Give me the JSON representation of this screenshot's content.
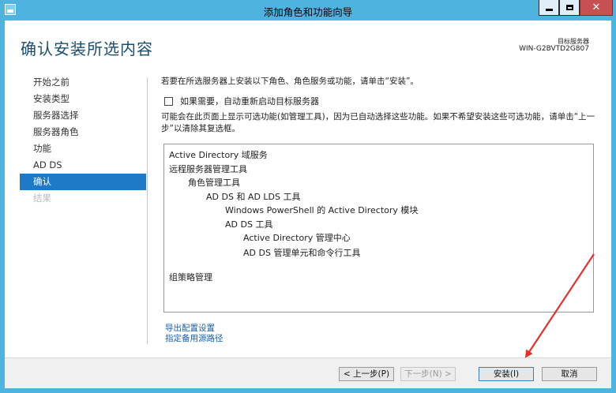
{
  "window": {
    "title": "添加角色和功能向导",
    "minimize_icon": "minimize-icon",
    "maximize_icon": "maximize-icon",
    "close_glyph": "✕"
  },
  "header": {
    "title": "确认安装所选内容",
    "target_label": "目标服务器",
    "target_name": "WIN-G2BVTD2G807"
  },
  "steps": [
    {
      "label": "开始之前",
      "state": "normal"
    },
    {
      "label": "安装类型",
      "state": "normal"
    },
    {
      "label": "服务器选择",
      "state": "normal"
    },
    {
      "label": "服务器角色",
      "state": "normal"
    },
    {
      "label": "功能",
      "state": "normal"
    },
    {
      "label": "AD DS",
      "state": "normal"
    },
    {
      "label": "确认",
      "state": "active"
    },
    {
      "label": "结果",
      "state": "disabled"
    }
  ],
  "content": {
    "intro": "若要在所选服务器上安装以下角色、角色服务或功能，请单击“安装”。",
    "restart_checkbox_label": "如果需要，自动重新启动目标服务器",
    "restart_checked": false,
    "note": "可能会在此页面上显示可选功能(如管理工具)，因为已自动选择这些功能。如果不希望安装这些可选功能，请单击“上一步”以清除其复选框。"
  },
  "items": [
    {
      "text": "Active Directory 域服务",
      "level": 0
    },
    {
      "text": "远程服务器管理工具",
      "level": 0
    },
    {
      "text": "角色管理工具",
      "level": 1
    },
    {
      "text": "AD DS 和 AD LDS 工具",
      "level": 2
    },
    {
      "text": "Windows PowerShell 的 Active Directory 模块",
      "level": 3
    },
    {
      "text": "AD DS 工具",
      "level": 3
    },
    {
      "text": "Active Directory 管理中心",
      "level": 4
    },
    {
      "text": "AD DS 管理单元和命令行工具",
      "level": 4
    },
    {
      "text": "组策略管理",
      "level": 0
    }
  ],
  "links": {
    "export": "导出配置设置",
    "alt_source": "指定备用源路径"
  },
  "buttons": {
    "prev": "< 上一步(P)",
    "next": "下一步(N) >",
    "install": "安装(I)",
    "cancel": "取消"
  },
  "colors": {
    "titlebar": "#4fb3e0",
    "active_step": "#1e7ac6",
    "annotation_arrow": "#e8302a",
    "link": "#1a5fa8"
  }
}
